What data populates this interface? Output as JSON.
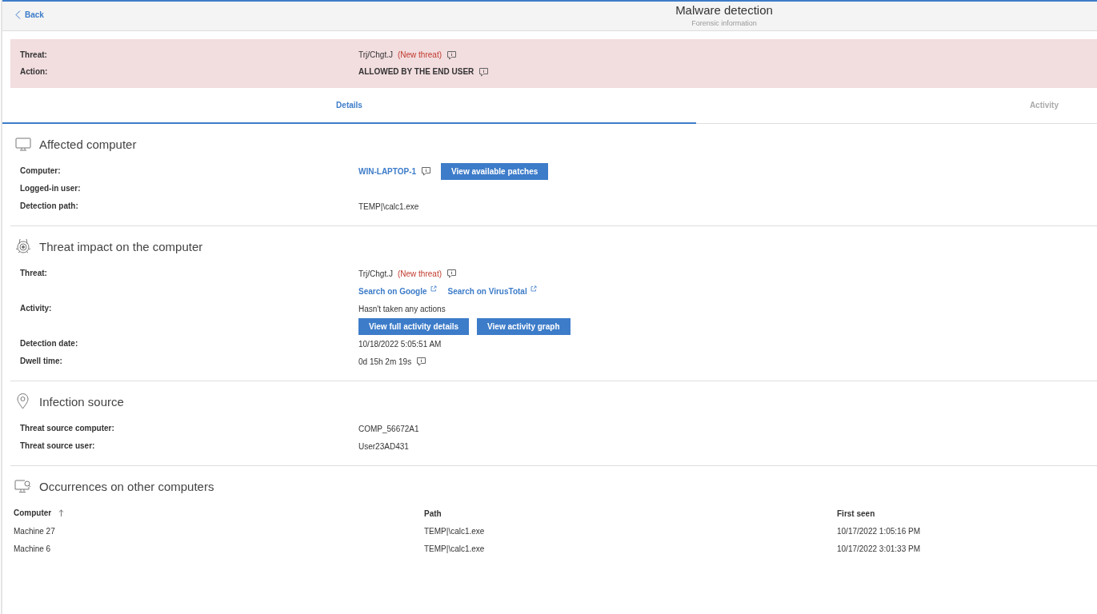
{
  "header": {
    "back": "Back",
    "title": "Malware detection",
    "subtitle": "Forensic information"
  },
  "banner": [
    {
      "label": "Threat:",
      "items": [
        {
          "kind": "text",
          "text": "Trj/Chgt.J"
        },
        {
          "kind": "tag",
          "text": "(New threat)"
        },
        {
          "kind": "info"
        }
      ]
    },
    {
      "label": "Action:",
      "items": [
        {
          "kind": "strong",
          "text": "ALLOWED BY THE END USER"
        },
        {
          "kind": "info"
        }
      ]
    }
  ],
  "tabs": [
    {
      "label": "Details",
      "selected": true
    },
    {
      "label": "Activity",
      "selected": false
    }
  ],
  "sections": [
    {
      "kind": "computer",
      "title": "Affected computer",
      "rows": [
        {
          "label": "Computer:",
          "lines": [
            [
              {
                "kind": "link",
                "text": "WIN-LAPTOP-1"
              },
              {
                "kind": "info"
              },
              {
                "kind": "button",
                "text": "View available patches"
              }
            ]
          ]
        },
        {
          "label": "Logged-in user:",
          "lines": []
        },
        {
          "label": "Detection path:",
          "lines": [
            [
              {
                "kind": "text",
                "text": "TEMP|\\calc1.exe"
              }
            ]
          ]
        }
      ]
    },
    {
      "kind": "threat",
      "title": "Threat impact on the computer",
      "rows": [
        {
          "label": "Threat:",
          "lines": [
            [
              {
                "kind": "text",
                "text": "Trj/Chgt.J"
              },
              {
                "kind": "tag",
                "text": "(New threat)"
              },
              {
                "kind": "info"
              }
            ],
            [
              {
                "kind": "ext_link",
                "text": "Search on Google"
              },
              {
                "kind": "ext_link",
                "text": "Search on VirusTotal"
              }
            ]
          ]
        },
        {
          "label": "Activity:",
          "lines": [
            [
              {
                "kind": "text",
                "text": "Hasn't taken any actions"
              }
            ],
            [
              {
                "kind": "button",
                "text": "View full activity details"
              },
              {
                "kind": "button",
                "text": "View activity graph"
              }
            ]
          ]
        },
        {
          "label": "Detection date:",
          "lines": [
            [
              {
                "kind": "text",
                "text": "10/18/2022 5:05:51 AM"
              }
            ]
          ]
        },
        {
          "label": "Dwell time:",
          "lines": [
            [
              {
                "kind": "text",
                "text": "0d 15h 2m 19s"
              },
              {
                "kind": "info"
              }
            ]
          ]
        }
      ]
    },
    {
      "kind": "pin",
      "title": "Infection source",
      "rows": [
        {
          "label": "Threat source computer:",
          "lines": [
            [
              {
                "kind": "text",
                "text": "COMP_56672A1"
              }
            ]
          ]
        },
        {
          "label": "Threat source user:",
          "lines": [
            [
              {
                "kind": "text",
                "text": "User23AD431"
              }
            ]
          ]
        }
      ]
    },
    {
      "kind": "computer_search",
      "title": "Occurrences on other computers",
      "table": {
        "columns": [
          {
            "label": "Computer",
            "sorted": true
          },
          {
            "label": "Path",
            "sorted": false
          },
          {
            "label": "First seen",
            "sorted": false
          }
        ],
        "rows": [
          [
            "Machine 27",
            "TEMP|\\calc1.exe",
            "10/17/2022 1:05:16 PM"
          ],
          [
            "Machine 6",
            "TEMP|\\calc1.exe",
            "10/17/2022 3:01:33 PM"
          ]
        ]
      }
    }
  ]
}
